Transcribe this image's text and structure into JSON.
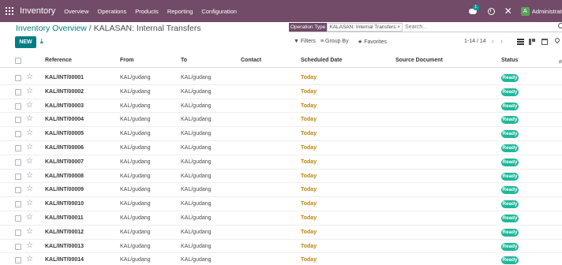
{
  "navbar": {
    "brand": "Inventory",
    "menu": [
      "Overview",
      "Operations",
      "Products",
      "Reporting",
      "Configuration"
    ],
    "chat_badge": "1",
    "avatar_initial": "A",
    "user_name": "Administrator",
    "bg_color": "#714b67"
  },
  "breadcrumb": {
    "parent": "Inventory Overview",
    "separator": " / ",
    "current": "KALASAN: Internal Transfers"
  },
  "search": {
    "facet_label": "Operation Type",
    "facet_value": "KALASAN: Internal Transfers",
    "facet_close": "×",
    "placeholder": "Search..."
  },
  "toolbar": {
    "new_label": "NEW",
    "download_icon": "download-icon"
  },
  "filters": {
    "filters_label": "▼ Filters",
    "group_by_label": "≡ Group By",
    "favorites_label": "★ Favorites"
  },
  "pager": {
    "range": "1-14 / 14",
    "prev": "‹",
    "next": "›"
  },
  "table": {
    "columns": {
      "reference": "Reference",
      "from": "From",
      "to": "To",
      "contact": "Contact",
      "scheduled_date": "Scheduled Date",
      "source_document": "Source Document",
      "status": "Status"
    },
    "rows": [
      {
        "reference": "KAL/INT/00001",
        "from": "KAL/gudang",
        "to": "KAL/gudang",
        "scheduled_date": "Today",
        "status": "Ready"
      },
      {
        "reference": "KAL/INT/00002",
        "from": "KAL/gudang",
        "to": "KAL/gudang",
        "scheduled_date": "Today",
        "status": "Ready"
      },
      {
        "reference": "KAL/INT/00003",
        "from": "KAL/gudang",
        "to": "KAL/gudang",
        "scheduled_date": "Today",
        "status": "Ready"
      },
      {
        "reference": "KAL/INT/00004",
        "from": "KAL/gudang",
        "to": "KAL/gudang",
        "scheduled_date": "Today",
        "status": "Ready"
      },
      {
        "reference": "KAL/INT/00005",
        "from": "KAL/gudang",
        "to": "KAL/gudang",
        "scheduled_date": "Today",
        "status": "Ready"
      },
      {
        "reference": "KAL/INT/00006",
        "from": "KAL/gudang",
        "to": "KAL/gudang",
        "scheduled_date": "Today",
        "status": "Ready"
      },
      {
        "reference": "KAL/INT/00007",
        "from": "KAL/gudang",
        "to": "KAL/gudang",
        "scheduled_date": "Today",
        "status": "Ready"
      },
      {
        "reference": "KAL/INT/00008",
        "from": "KAL/gudang",
        "to": "KAL/gudang",
        "scheduled_date": "Today",
        "status": "Ready"
      },
      {
        "reference": "KAL/INT/00009",
        "from": "KAL/gudang",
        "to": "KAL/gudang",
        "scheduled_date": "Today",
        "status": "Ready"
      },
      {
        "reference": "KAL/INT/00010",
        "from": "KAL/gudang",
        "to": "KAL/gudang",
        "scheduled_date": "Today",
        "status": "Ready"
      },
      {
        "reference": "KAL/INT/00011",
        "from": "KAL/gudang",
        "to": "KAL/gudang",
        "scheduled_date": "Today",
        "status": "Ready"
      },
      {
        "reference": "KAL/INT/00012",
        "from": "KAL/gudang",
        "to": "KAL/gudang",
        "scheduled_date": "Today",
        "status": "Ready"
      },
      {
        "reference": "KAL/INT/00013",
        "from": "KAL/gudang",
        "to": "KAL/gudang",
        "scheduled_date": "Today",
        "status": "Ready"
      },
      {
        "reference": "KAL/INT/00014",
        "from": "KAL/gudang",
        "to": "KAL/gudang",
        "scheduled_date": "Today",
        "status": "Ready"
      }
    ]
  },
  "colors": {
    "accent": "#017e84",
    "ready_badge": "#21b799",
    "today": "#b8860b"
  }
}
